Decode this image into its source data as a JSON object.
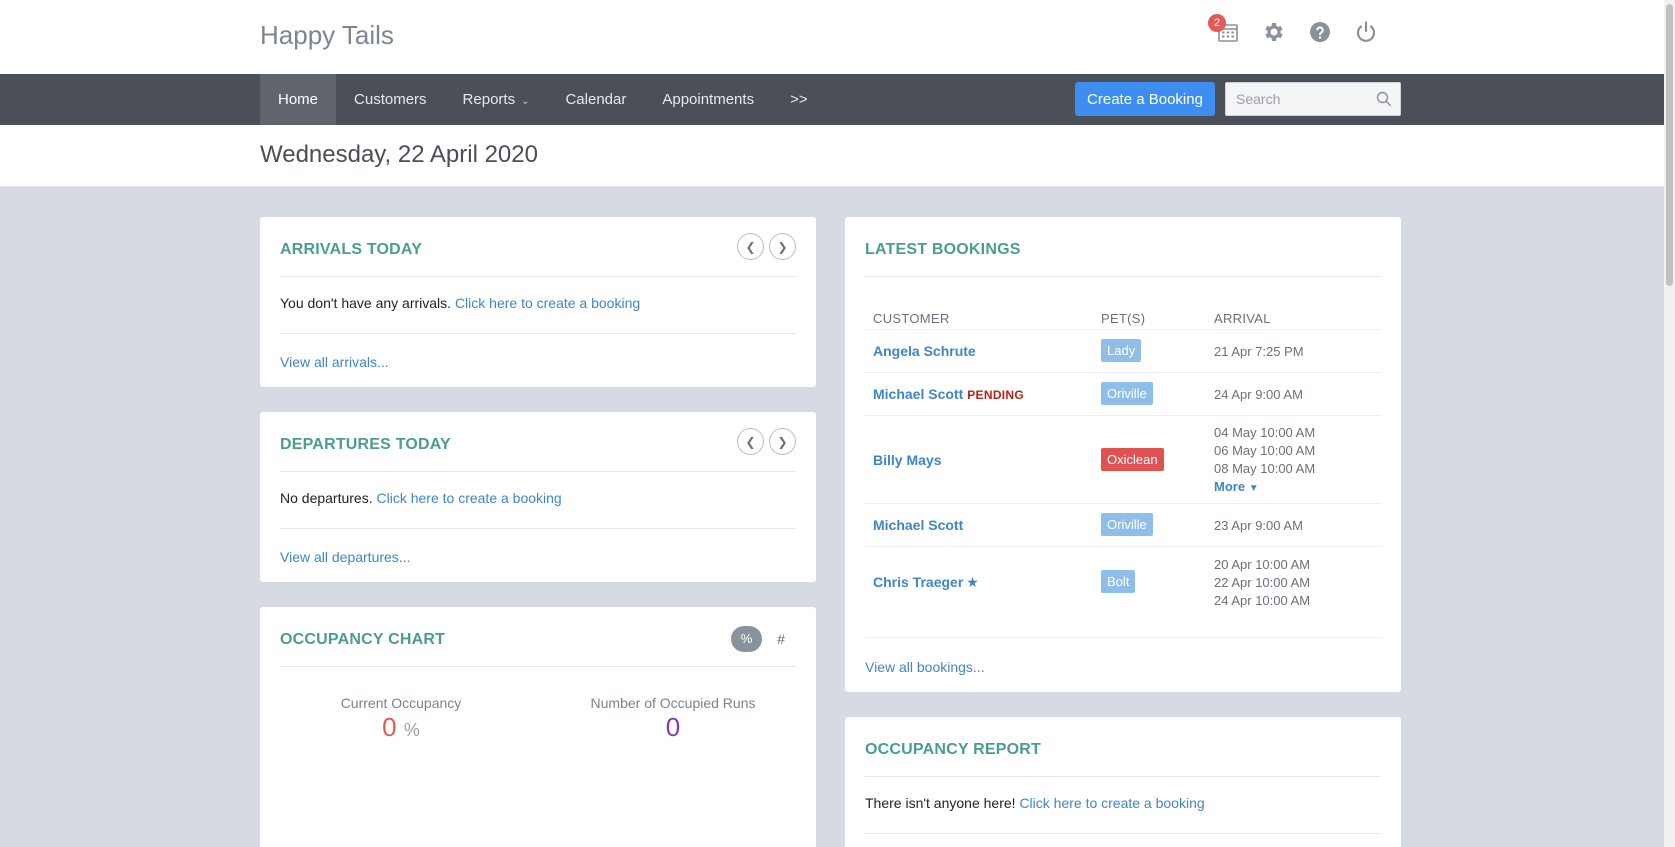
{
  "brand": "Happy Tails",
  "notifications": {
    "count": "2"
  },
  "nav": {
    "items": [
      "Home",
      "Customers",
      "Reports",
      "Calendar",
      "Appointments",
      ">>"
    ],
    "create_button": "Create a Booking",
    "search_placeholder": "Search"
  },
  "date": "Wednesday, 22 April 2020",
  "arrivals": {
    "title": "ARRIVALS TODAY",
    "message": "You don't have any arrivals.",
    "create_link": "Click here to create a booking",
    "view_all": "View all arrivals..."
  },
  "departures": {
    "title": "DEPARTURES TODAY",
    "message": "No departures.",
    "create_link": "Click here to create a booking",
    "view_all": "View all departures..."
  },
  "occupancy_chart": {
    "title": "OCCUPANCY CHART",
    "toggle_pct": "%",
    "toggle_num": "#",
    "current_label": "Current Occupancy",
    "current_value": "0",
    "current_unit": "%",
    "runs_label": "Number of Occupied Runs",
    "runs_value": "0"
  },
  "latest_bookings": {
    "title": "LATEST BOOKINGS",
    "columns": [
      "CUSTOMER",
      "PET(S)",
      "ARRIVAL"
    ],
    "rows": [
      {
        "customer": "Angela Schrute",
        "status": "",
        "starred": false,
        "pet": "Lady",
        "pet_color": "#8fbfe8",
        "arrivals": [
          "21 Apr 7:25 PM"
        ],
        "more": ""
      },
      {
        "customer": "Michael Scott",
        "status": "PENDING",
        "starred": false,
        "pet": "Oriville",
        "pet_color": "#8fbfe8",
        "arrivals": [
          "24 Apr 9:00 AM"
        ],
        "more": ""
      },
      {
        "customer": "Billy Mays",
        "status": "",
        "starred": false,
        "pet": "Oxiclean",
        "pet_color": "#e05252",
        "arrivals": [
          "04 May 10:00 AM",
          "06 May 10:00 AM",
          "08 May 10:00 AM"
        ],
        "more": "More"
      },
      {
        "customer": "Michael Scott",
        "status": "",
        "starred": false,
        "pet": "Oriville",
        "pet_color": "#8fbfe8",
        "arrivals": [
          "23 Apr 9:00 AM"
        ],
        "more": ""
      },
      {
        "customer": "Chris Traeger",
        "status": "",
        "starred": true,
        "pet": "Bolt",
        "pet_color": "#8fbfe8",
        "arrivals": [
          "20 Apr 10:00 AM",
          "22 Apr 10:00 AM",
          "24 Apr 10:00 AM"
        ],
        "more": ""
      }
    ],
    "view_all": "View all bookings..."
  },
  "occupancy_report": {
    "title": "OCCUPANCY REPORT",
    "message": "There isn't anyone here!",
    "create_link": "Click here to create a booking"
  },
  "colors": {
    "accent": "#3d8ef0",
    "title": "#4a9d8f",
    "link": "#3f86c6",
    "navbar": "#4b5058",
    "pending": "#b42318",
    "occupancy_value": "#e35a56",
    "runs_value": "#7b3fb5"
  },
  "icons": [
    "calendar-icon",
    "gear-icon",
    "help-icon",
    "power-icon",
    "search-icon",
    "chevron-left-icon",
    "chevron-right-icon",
    "chevron-down-icon",
    "star-icon",
    "caret-down-icon"
  ]
}
